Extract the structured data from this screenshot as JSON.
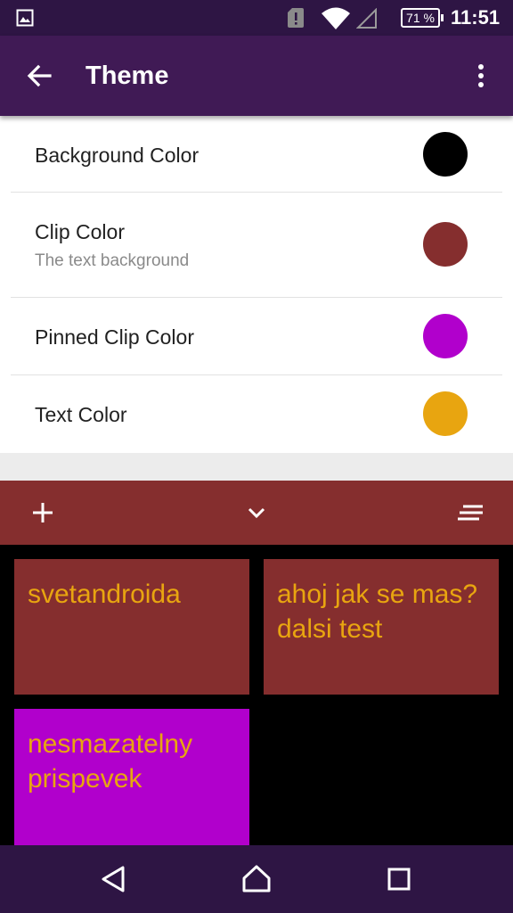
{
  "status_bar": {
    "battery": "71 %",
    "time": "11:51",
    "icons": [
      "gallery-icon",
      "sim-alert-icon",
      "wifi-icon",
      "signal-icon",
      "battery-icon"
    ]
  },
  "app_bar": {
    "title": "Theme",
    "icons": [
      "back-arrow-icon",
      "more-vert-icon"
    ]
  },
  "settings": [
    {
      "label": "Background Color",
      "summary": "",
      "color": "#000000"
    },
    {
      "label": "Clip Color",
      "summary": "The text background",
      "color": "#852e2e"
    },
    {
      "label": "Pinned Clip Color",
      "summary": "",
      "color": "#b100cc"
    },
    {
      "label": "Text Color",
      "summary": "",
      "color": "#e8a510"
    }
  ],
  "preview": {
    "toolbar_icons": [
      "plus-icon",
      "chevron-down-icon",
      "sort-lines-icon"
    ],
    "clips": [
      {
        "text": "svetandroida",
        "pinned": false
      },
      {
        "text": "ahoj jak se mas?dalsi test",
        "pinned": false
      },
      {
        "text": "nesmazatelny prispevek",
        "pinned": true
      }
    ]
  },
  "nav_bar": {
    "icons": [
      "nav-back-icon",
      "nav-home-icon",
      "nav-recents-icon"
    ]
  },
  "colors": {
    "status_bar": "#2e1544",
    "app_bar": "#401a55",
    "background": "#000000",
    "clip": "#852e2e",
    "pinned_clip": "#b100cc",
    "text": "#e8a510"
  }
}
